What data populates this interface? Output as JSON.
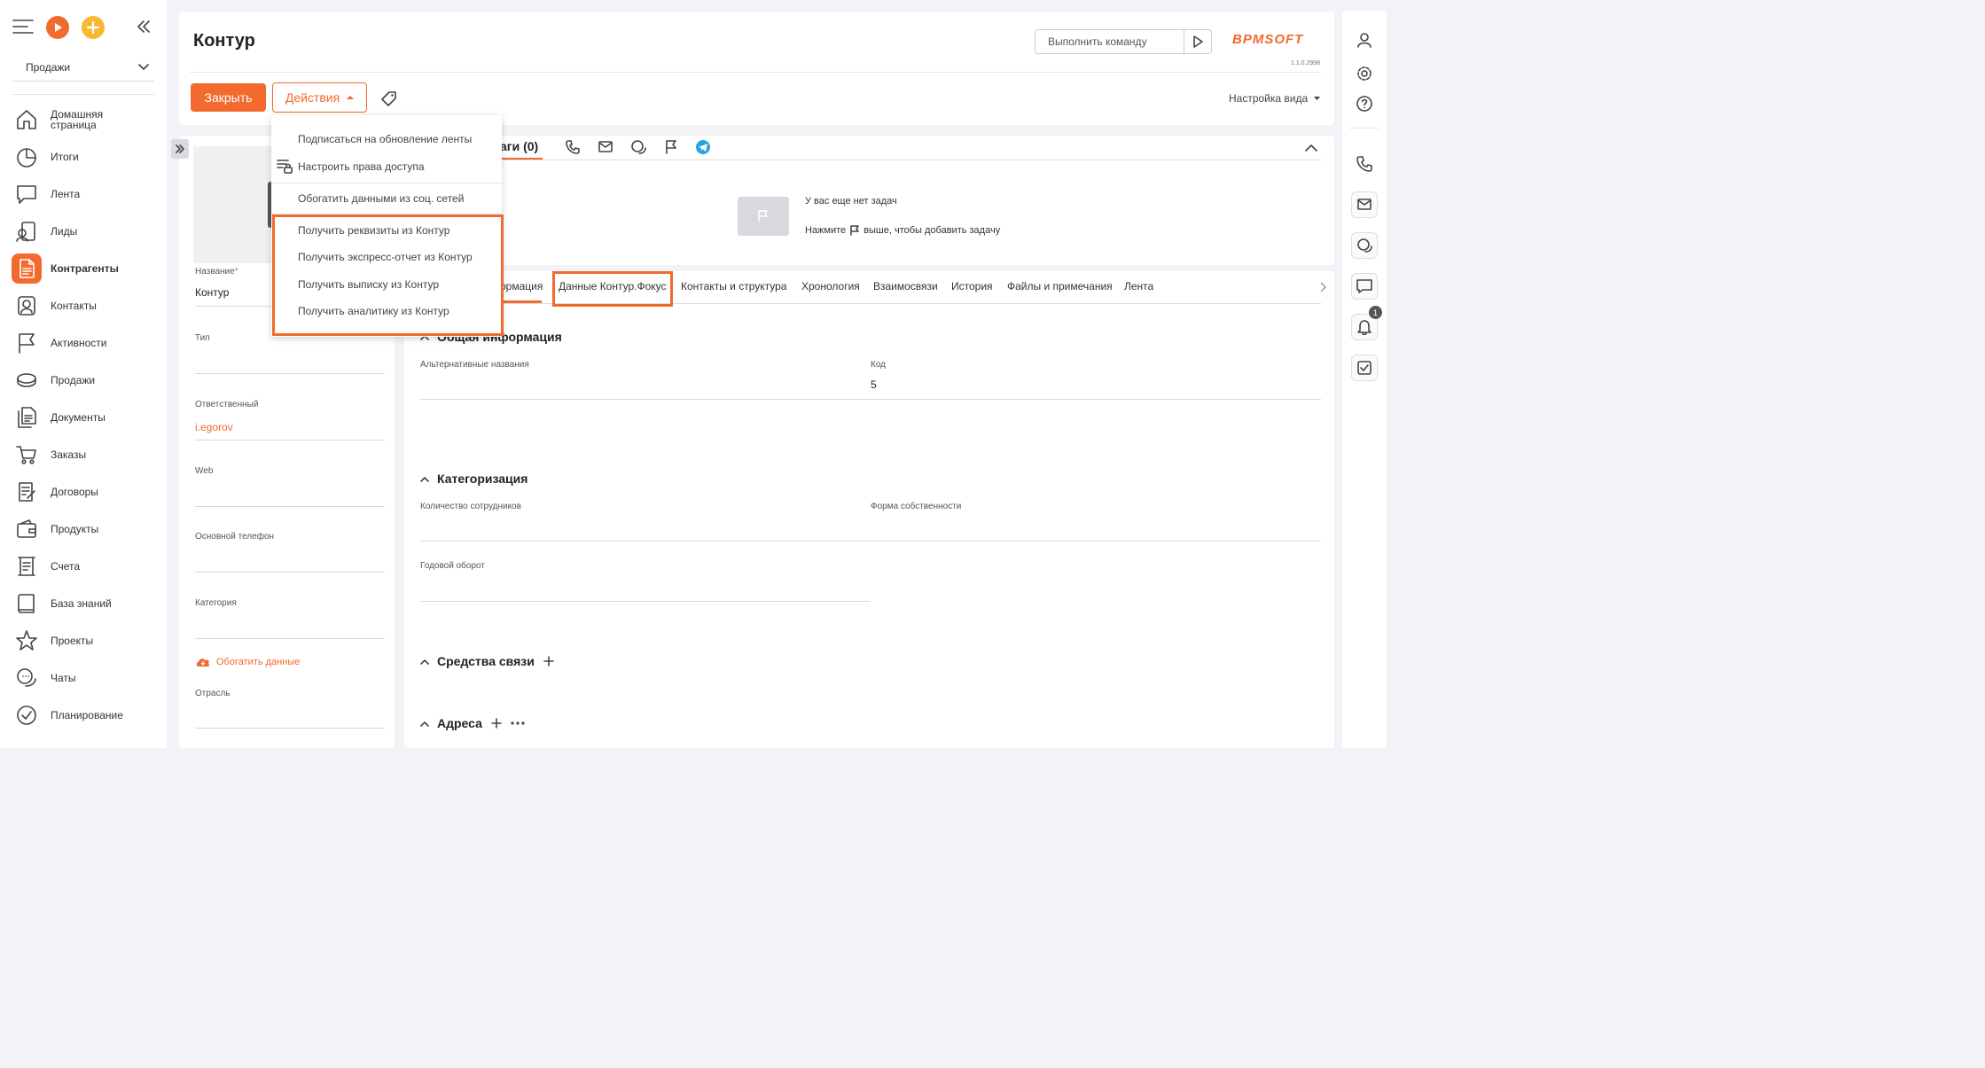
{
  "sidebar": {
    "section": "Продажи",
    "items": [
      {
        "label_line1": "Домашняя",
        "label_line2": "страница",
        "icon": "home-icon"
      },
      {
        "label_line1": "Итоги",
        "icon": "pie-chart-icon"
      },
      {
        "label_line1": "Лента",
        "icon": "feed-icon"
      },
      {
        "label_line1": "Лиды",
        "icon": "leads-icon"
      },
      {
        "label_line1": "Контрагенты",
        "icon": "accounts-icon",
        "active": true
      },
      {
        "label_line1": "Контакты",
        "icon": "contacts-icon"
      },
      {
        "label_line1": "Активности",
        "icon": "flag-icon"
      },
      {
        "label_line1": "Продажи",
        "icon": "sales-icon"
      },
      {
        "label_line1": "Документы",
        "icon": "documents-icon"
      },
      {
        "label_line1": "Заказы",
        "icon": "cart-icon"
      },
      {
        "label_line1": "Договоры",
        "icon": "contracts-icon"
      },
      {
        "label_line1": "Продукты",
        "icon": "wallet-icon"
      },
      {
        "label_line1": "Счета",
        "icon": "invoice-icon"
      },
      {
        "label_line1": "База знаний",
        "icon": "book-icon"
      },
      {
        "label_line1": "Проекты",
        "icon": "star-icon"
      },
      {
        "label_line1": "Чаты",
        "icon": "chat-icon"
      },
      {
        "label_line1": "Планирование",
        "icon": "check-circle-icon"
      }
    ]
  },
  "header": {
    "title": "Контур",
    "command_placeholder": "Выполнить команду",
    "logo": "BPMSOFT",
    "version": "1.1.0.2998",
    "close_label": "Закрыть",
    "actions_label": "Действия",
    "view_settings_label": "Настройка вида"
  },
  "dropdown": {
    "items": [
      "Подписаться на обновление ленты",
      "Настроить права доступа",
      "Обогатить данными из соц. сетей",
      "Получить реквизиты из Контур",
      "Получить экспресс-отчет из Контур",
      "Получить выписку из Контур",
      "Получить аналитику из Контур"
    ]
  },
  "profile": {
    "name_label": "Название",
    "name_value": "Контур",
    "type_label": "Тип",
    "owner_label": "Ответственный",
    "owner_value": "i.egorov",
    "web_label": "Web",
    "phone_label": "Основной телефон",
    "category_label": "Категория",
    "enrich_label": "Обогатить данные",
    "industry_label": "Отрасль"
  },
  "tasks": {
    "tab_label_partial": "аги (0)",
    "empty_text": "У вас еще нет задач",
    "hint_before": "Нажмите",
    "hint_after": "выше, чтобы добавить задачу"
  },
  "tabs": [
    "ормация",
    "Данные Контур.Фокус",
    "Контакты и структура",
    "Хронология",
    "Взаимосвязи",
    "История",
    "Файлы и примечания",
    "Лента"
  ],
  "general": {
    "title_partial": "Общая информация",
    "alt_names_label": "Альтернативные названия",
    "code_label": "Код",
    "code_value": "5"
  },
  "categorization": {
    "title": "Категоризация",
    "employees_label": "Количество сотрудников",
    "ownership_label": "Форма собственности",
    "turnover_label": "Годовой оборот"
  },
  "communications": {
    "title": "Средства связи"
  },
  "addresses": {
    "title": "Адреса"
  },
  "notifications": {
    "count": "1"
  },
  "colors": {
    "accent": "#f26a2e"
  }
}
